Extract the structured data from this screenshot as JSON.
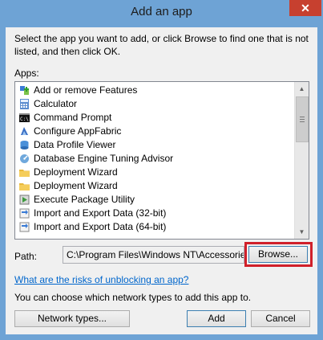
{
  "window": {
    "title": "Add an app",
    "close_glyph": "✕"
  },
  "description": "Select the app you want to add, or click Browse to find one that is not listed, and then click OK.",
  "apps_label": "Apps:",
  "apps": [
    {
      "label": "Add or remove Features",
      "icon": "features-icon"
    },
    {
      "label": "Calculator",
      "icon": "calculator-icon"
    },
    {
      "label": "Command Prompt",
      "icon": "command-prompt-icon"
    },
    {
      "label": "Configure AppFabric",
      "icon": "appfabric-icon"
    },
    {
      "label": "Data Profile Viewer",
      "icon": "data-profile-icon"
    },
    {
      "label": "Database Engine Tuning Advisor",
      "icon": "tuning-advisor-icon"
    },
    {
      "label": "Deployment Wizard",
      "icon": "deployment-wizard-icon"
    },
    {
      "label": "Deployment Wizard",
      "icon": "deployment-wizard-icon"
    },
    {
      "label": "Execute Package Utility",
      "icon": "execute-package-icon"
    },
    {
      "label": "Import and Export Data (32-bit)",
      "icon": "import-export-icon"
    },
    {
      "label": "Import and Export Data (64-bit)",
      "icon": "import-export-icon"
    }
  ],
  "path": {
    "label": "Path:",
    "value": "C:\\Program Files\\Windows NT\\Accessories\\wordpad.exe"
  },
  "browse_label": "Browse...",
  "risk_link": "What are the risks of unblocking an app?",
  "network_text": "You can choose which network types to add this app to.",
  "buttons": {
    "network_types": "Network types...",
    "add": "Add",
    "cancel": "Cancel"
  },
  "colors": {
    "title_bar": "#6ea3d5",
    "close": "#c7402f",
    "highlight": "#d0202a",
    "link": "#0066cc"
  }
}
